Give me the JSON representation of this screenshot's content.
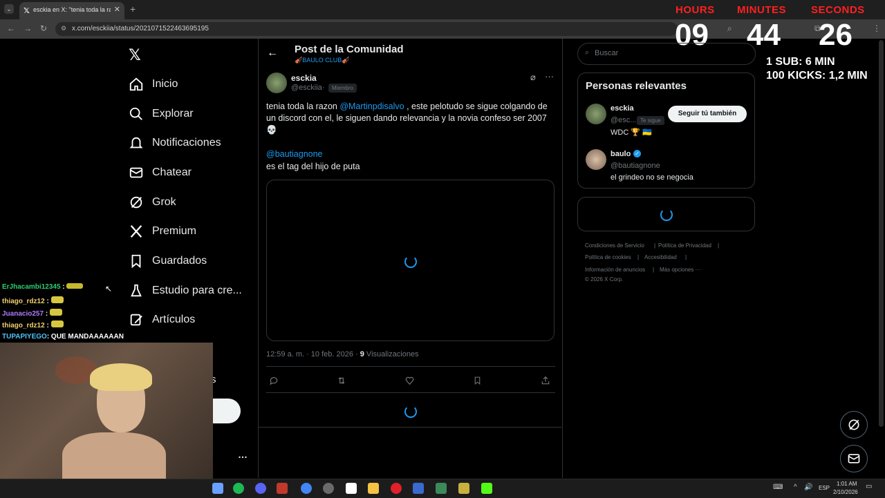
{
  "browser": {
    "tab_title": "esckia en X: \"tenia toda la razon",
    "url": "x.com/esckiia/status/2021071522463695195"
  },
  "timer": {
    "hours_label": "HOURS",
    "minutes_label": "MINUTES",
    "seconds_label": "SECONDS",
    "hours": "09",
    "minutes": "44",
    "seconds": "26",
    "rule1": "1 SUB: 6 MIN",
    "rule2": "100 KICKS: 1,2 MIN"
  },
  "sidebar": {
    "items": [
      {
        "label": "Inicio",
        "icon": "home-icon"
      },
      {
        "label": "Explorar",
        "icon": "search-icon"
      },
      {
        "label": "Notificaciones",
        "icon": "bell-icon"
      },
      {
        "label": "Chatear",
        "icon": "mail-icon"
      },
      {
        "label": "Grok",
        "icon": "grok-icon"
      },
      {
        "label": "Premium",
        "icon": "x-logo-icon"
      },
      {
        "label": "Guardados",
        "icon": "bookmark-icon"
      },
      {
        "label": "Estudio para cre...",
        "icon": "flask-icon"
      },
      {
        "label": "Artículos",
        "icon": "pencil-icon"
      }
    ],
    "partial_letter": "s",
    "more": "…"
  },
  "post": {
    "header_title": "Post de la Comunidad",
    "community": "🎻BAULO CLUB🎻",
    "author_name": "esckia",
    "author_handle": "@esckiia",
    "badge": "Miembro",
    "text_part1": "tenia toda la razon ",
    "mention1": "@Martinpdisalvo",
    "text_part2": " , este pelotudo se sigue colgando de un discord con el, le siguen dando relevancia y la novia confeso ser 2007",
    "skull": "💀",
    "mention2": "@bautiagnone",
    "text_part3": "es el tag del hijo de puta",
    "time": "12:59 a. m. · 10 feb. 2026 · ",
    "views_count": "9",
    "views_label": " Visualizaciones"
  },
  "right": {
    "search_placeholder": "Buscar",
    "relevant_title": "Personas relevantes",
    "person1": {
      "name": "esckia",
      "handle": "@esc...",
      "follows_you": "Te sigue",
      "bio": "WDC 🏆 🇺🇦",
      "follow_button": "Seguir tú también"
    },
    "person2": {
      "name": "baulo",
      "handle": "@bautiagnone",
      "bio": "el grindeo no se negocia"
    },
    "footer": {
      "l1": "Condiciones de Servicio",
      "l2": "Política de Privacidad",
      "l3": "Política de cookies",
      "l4": "Accesibilidad",
      "l5": "Información de anuncios",
      "l6": "Más opciones ···",
      "copy": "© 2026 X Corp."
    }
  },
  "chat": [
    {
      "user": "ErJhacambi12345",
      "msg": ":",
      "color": "#2ecc71"
    },
    {
      "user": "thiago_rdz12",
      "msg": ":",
      "color": "#f0d070"
    },
    {
      "user": "Juanacio257",
      "msg": ":",
      "color": "#b07cff"
    },
    {
      "user": "thiago_rdz12",
      "msg": ":",
      "color": "#f0d070"
    },
    {
      "user": "TUPAPIYEGO",
      "msg": ": QUE MANDAAAAAAN",
      "color": "#4fc3f7"
    }
  ],
  "taskbar": {
    "lang": "ESP",
    "time": "1:01 AM",
    "date": "2/10/2026"
  },
  "colors": {
    "accent": "#1d9bf0",
    "bg": "#000000",
    "timer_red": "#ff2020"
  }
}
